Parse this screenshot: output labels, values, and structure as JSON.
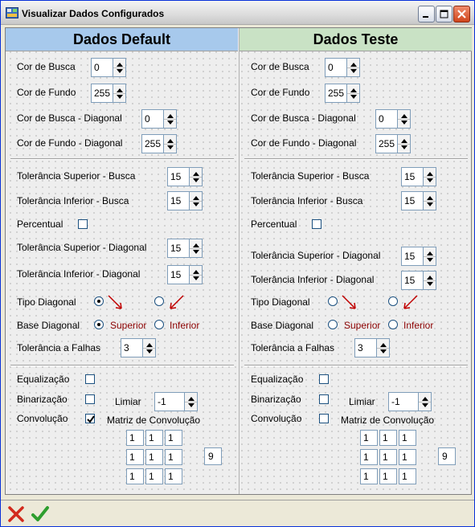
{
  "window": {
    "title": "Visualizar Dados Configurados",
    "controls": [
      "minimize-icon",
      "maximize-icon",
      "close-icon"
    ]
  },
  "colors": {
    "default_header": "#A7C9EC",
    "teste_header": "#C9E2C5",
    "arrow": "#C00000",
    "label_red": "#8B0000"
  },
  "left": {
    "header": "Dados Default",
    "cor_busca": {
      "label": "Cor de Busca",
      "value": "0"
    },
    "cor_fundo": {
      "label": "Cor de Fundo",
      "value": "255"
    },
    "cor_busca_diag": {
      "label": "Cor de Busca - Diagonal",
      "value": "0"
    },
    "cor_fundo_diag": {
      "label": "Cor de Fundo - Diagonal",
      "value": "255"
    },
    "tol_sup_busca": {
      "label": "Tolerância Superior - Busca",
      "value": "15"
    },
    "tol_inf_busca": {
      "label": "Tolerância Inferior - Busca",
      "value": "15"
    },
    "percentual": {
      "label": "Percentual",
      "checked": false
    },
    "tol_sup_diag": {
      "label": "Tolerância Superior - Diagonal",
      "value": "15"
    },
    "tol_inf_diag": {
      "label": "Tolerância Inferior - Diagonal",
      "value": "15"
    },
    "tipo_diagonal": {
      "label": "Tipo Diagonal",
      "selected": "down-right"
    },
    "base_diagonal": {
      "label": "Base Diagonal",
      "opt1": "Superior",
      "opt2": "Inferior",
      "selected": "Superior"
    },
    "tol_falhas": {
      "label": "Tolerância a Falhas",
      "value": "3"
    },
    "equalizacao": {
      "label": "Equalização",
      "checked": false
    },
    "binarizacao": {
      "label": "Binarização",
      "checked": false
    },
    "limiar": {
      "label": "Limiar",
      "value": "-1"
    },
    "convolucao": {
      "label": "Convolução",
      "checked": true
    },
    "matriz_label": "Matriz de Convolução",
    "matriz": [
      "1",
      "1",
      "1",
      "1",
      "1",
      "1",
      "1",
      "1",
      "1"
    ],
    "matriz_div": "9"
  },
  "right": {
    "header": "Dados Teste",
    "cor_busca": {
      "label": "Cor de Busca",
      "value": "0"
    },
    "cor_fundo": {
      "label": "Cor de Fundo",
      "value": "255"
    },
    "cor_busca_diag": {
      "label": "Cor de Busca - Diagonal",
      "value": "0"
    },
    "cor_fundo_diag": {
      "label": "Cor de Fundo - Diagonal",
      "value": "255"
    },
    "tol_sup_busca": {
      "label": "Tolerância Superior - Busca",
      "value": "15"
    },
    "tol_inf_busca": {
      "label": "Tolerância Inferior - Busca",
      "value": "15"
    },
    "percentual": {
      "label": "Percentual",
      "checked": false
    },
    "tol_sup_diag": {
      "label": "Tolerância Superior - Diagonal",
      "value": "15"
    },
    "tol_inf_diag": {
      "label": "Tolerância Inferior - Diagonal",
      "value": "15"
    },
    "tipo_diagonal": {
      "label": "Tipo Diagonal",
      "selected": "none"
    },
    "base_diagonal": {
      "label": "Base Diagonal",
      "opt1": "Superior",
      "opt2": "Inferior",
      "selected": "none"
    },
    "tol_falhas": {
      "label": "Tolerância a Falhas",
      "value": "3"
    },
    "equalizacao": {
      "label": "Equalização",
      "checked": false
    },
    "binarizacao": {
      "label": "Binarização",
      "checked": false
    },
    "limiar": {
      "label": "Limiar",
      "value": "-1"
    },
    "convolucao": {
      "label": "Convolução",
      "checked": false
    },
    "matriz_label": "Matriz de Convolução",
    "matriz": [
      "1",
      "1",
      "1",
      "1",
      "1",
      "1",
      "1",
      "1",
      "1"
    ],
    "matriz_div": "9"
  },
  "footer": {
    "buttons": [
      "cancel-icon",
      "confirm-icon"
    ]
  }
}
